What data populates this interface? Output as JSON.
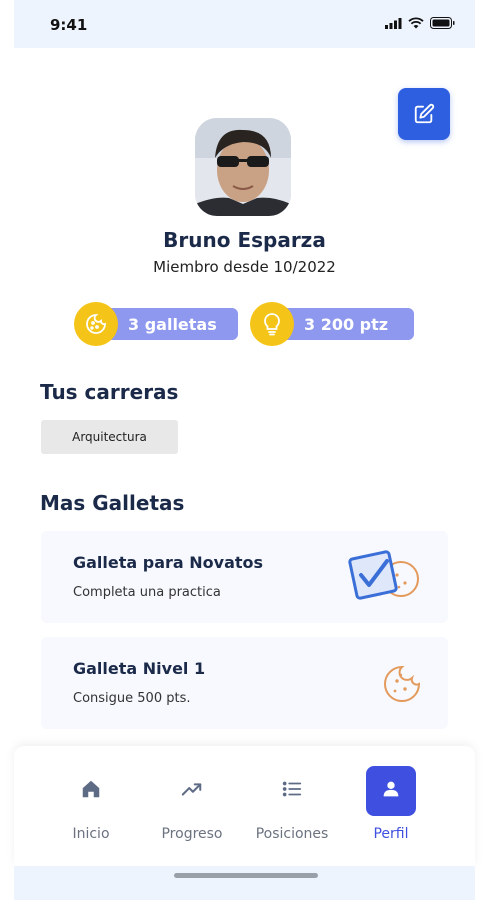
{
  "status": {
    "time": "9:41"
  },
  "profile": {
    "name": "Bruno Esparza",
    "member_since": "Miembro desde 10/2022",
    "badges": [
      {
        "label": "3 galletas",
        "icon": "cookie-icon"
      },
      {
        "label": "3 200 ptz",
        "icon": "lightbulb-icon"
      }
    ]
  },
  "careers": {
    "title": "Tus carreras",
    "items": [
      "Arquitectura"
    ]
  },
  "more_cookies": {
    "title": "Mas Galletas",
    "cards": [
      {
        "title": "Galleta para Novatos",
        "desc": "Completa una practica"
      },
      {
        "title": "Galleta Nivel 1",
        "desc": "Consigue 500 pts."
      }
    ]
  },
  "nav": {
    "items": [
      {
        "label": "Inicio",
        "icon": "home-icon"
      },
      {
        "label": "Progreso",
        "icon": "trend-icon"
      },
      {
        "label": "Posiciones",
        "icon": "list-icon"
      },
      {
        "label": "Perfil",
        "icon": "person-icon"
      }
    ],
    "active": "Perfil"
  },
  "colors": {
    "primary": "#2d5fe0",
    "pill": "#8d98ee",
    "badge_icon": "#f4c518",
    "nav_active": "#3f4fe0",
    "heading": "#1c2a4a"
  }
}
